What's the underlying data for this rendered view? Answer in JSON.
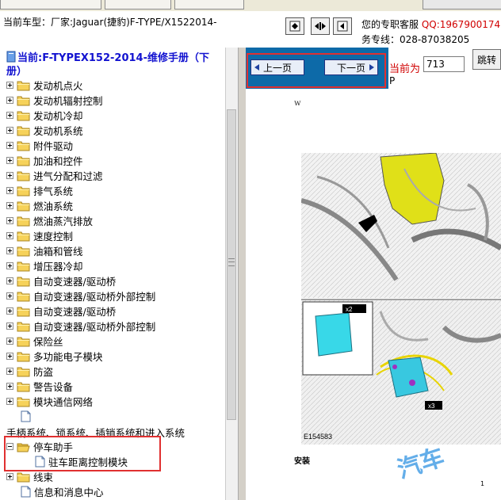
{
  "header": {
    "car_model": "当前车型：厂家:Jaguar(捷豹)F-TYPE/X1522014-",
    "service_line1_prefix": "您的专职客服",
    "service_qq": "QQ:1967900174",
    "service_line2": "务专线：028-87038205"
  },
  "tree": {
    "title": "当前:F-TYPEX152-2014-维修手册（下册）",
    "items": [
      {
        "label": "发动机点火"
      },
      {
        "label": "发动机辐射控制"
      },
      {
        "label": "发动机冷却"
      },
      {
        "label": "发动机系统"
      },
      {
        "label": "附件驱动"
      },
      {
        "label": "加油和控件"
      },
      {
        "label": "进气分配和过滤"
      },
      {
        "label": "排气系统"
      },
      {
        "label": "燃油系统"
      },
      {
        "label": "燃油蒸汽排放"
      },
      {
        "label": "速度控制"
      },
      {
        "label": "油箱和管线"
      },
      {
        "label": "增压器冷却"
      },
      {
        "label": "自动变速器/驱动桥"
      },
      {
        "label": "自动变速器/驱动桥外部控制"
      },
      {
        "label": "自动变速器/驱动桥"
      },
      {
        "label": "自动变速器/驱动桥外部控制"
      },
      {
        "label": "保险丝"
      },
      {
        "label": "多功能电子模块"
      },
      {
        "label": "防盗"
      },
      {
        "label": "警告设备"
      },
      {
        "label": "模块通信网络"
      }
    ],
    "section_label": "手柄系统、锁系统、插销系统和进入系统",
    "parking_assist": "停车助手",
    "parking_module": "驻车距离控制模块",
    "after_items": [
      {
        "label": "线束"
      },
      {
        "label": "信息和消息中心"
      }
    ]
  },
  "viewer": {
    "prev_label": "上一页",
    "next_label": "下一页",
    "current_label": "当前为",
    "page_value": "713",
    "page_unit": "P",
    "jump_label": "跳转",
    "doc_letter": "w",
    "figure_code": "E154583",
    "callout_1": "x2",
    "callout_2": "x3",
    "install_label": "安装",
    "watermark": "汽车",
    "page_number": "1"
  },
  "colors": {
    "title_blue": "#1212d0",
    "accent_red": "#d00000",
    "highlight_red": "#e03030",
    "nav_blue": "#0d6aa8",
    "folder_yellow": "#f6d25a"
  }
}
